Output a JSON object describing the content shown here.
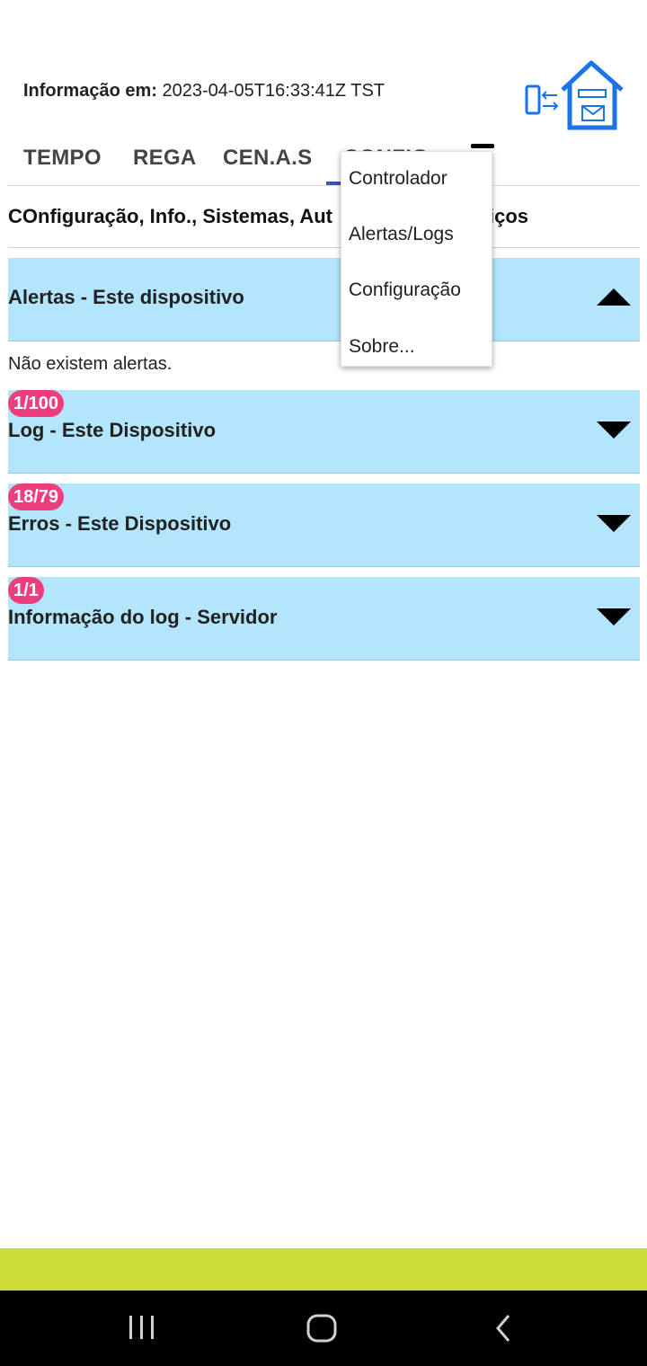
{
  "header": {
    "info_label": "Informação em:",
    "info_value": "2023-04-05T16:33:41Z TST",
    "logo_icon": "house-device-sync-icon"
  },
  "tabs": [
    {
      "label": "TEMPO"
    },
    {
      "label": "REGA"
    },
    {
      "label": "CEN.A.S"
    },
    {
      "label": "CONFIG"
    }
  ],
  "section_title": "COnfiguração, Info., Sistemas, Aut",
  "section_title_tail": "iços",
  "panels": {
    "alerts": {
      "title": "Alertas - Este dispositivo",
      "expanded": true,
      "empty_text": "Não existem alertas."
    },
    "log": {
      "title": "Log - Este Dispositivo",
      "badge": "1/100"
    },
    "errors": {
      "title": "Erros - Este Dispositivo",
      "badge": "18/79"
    },
    "server_log": {
      "title": "Informação do log - Servidor",
      "badge": "1/1"
    }
  },
  "menu": {
    "items": [
      {
        "label": "Controlador"
      },
      {
        "label": "Alertas/Logs"
      },
      {
        "label": "Configuração"
      },
      {
        "label": "Sobre..."
      }
    ]
  },
  "colors": {
    "panel_bg": "#b3e5fc",
    "badge_bg": "#ee3d7c",
    "tab_indicator": "#3f51b5",
    "footer_bar": "#cddc39",
    "logo": "#1a73e8"
  },
  "system_nav": {
    "recents_icon": "recents-icon",
    "home_icon": "home-icon",
    "back_icon": "back-icon"
  }
}
